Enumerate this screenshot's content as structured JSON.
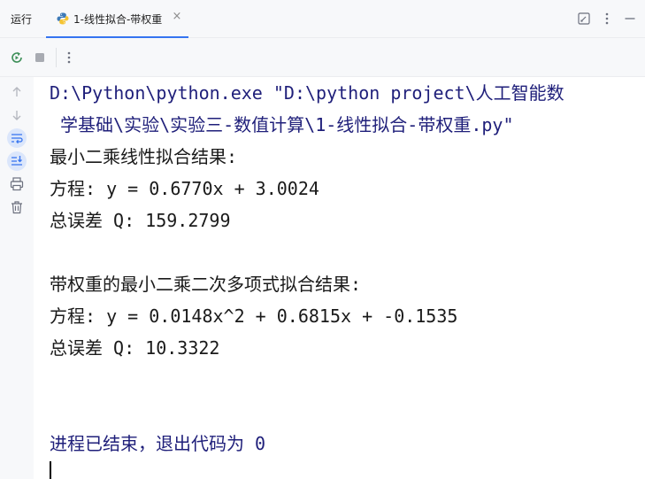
{
  "panel": {
    "title": "运行"
  },
  "tab": {
    "label": "1-线性拟合-带权重",
    "close": "×"
  },
  "console": {
    "command_line1": "D:\\Python\\python.exe \"D:\\python project\\人工智能数",
    "command_line2": " 学基础\\实验\\实验三-数值计算\\1-线性拟合-带权重.py\"",
    "linear_header": "最小二乘线性拟合结果:",
    "linear_equation": "方程: y = 0.6770x + 3.0024",
    "linear_error": "总误差 Q: 159.2799",
    "weighted_header": "带权重的最小二乘二次多项式拟合结果:",
    "weighted_equation": "方程: y = 0.0148x^2 + 0.6815x + -0.1535",
    "weighted_error": "总误差 Q: 10.3322",
    "exit_message": "进程已结束，退出代码为 0"
  },
  "colors": {
    "accent": "#3574f0",
    "toolbar_bg": "#f7f8fa",
    "command_text": "#1f1f7a",
    "rerun_green": "#3d8f58"
  },
  "icons": {
    "tab": "python-icon",
    "maximize": "maximize-icon",
    "more": "more-vertical-icon",
    "minimize": "minimize-icon",
    "rerun": "rerun-icon",
    "stop": "stop-icon",
    "scroll_up": "arrow-up-icon",
    "scroll_down": "arrow-down-icon",
    "soft_wrap": "soft-wrap-icon",
    "scroll_to_end": "scroll-to-end-icon",
    "print": "print-icon",
    "clear": "trash-icon"
  }
}
